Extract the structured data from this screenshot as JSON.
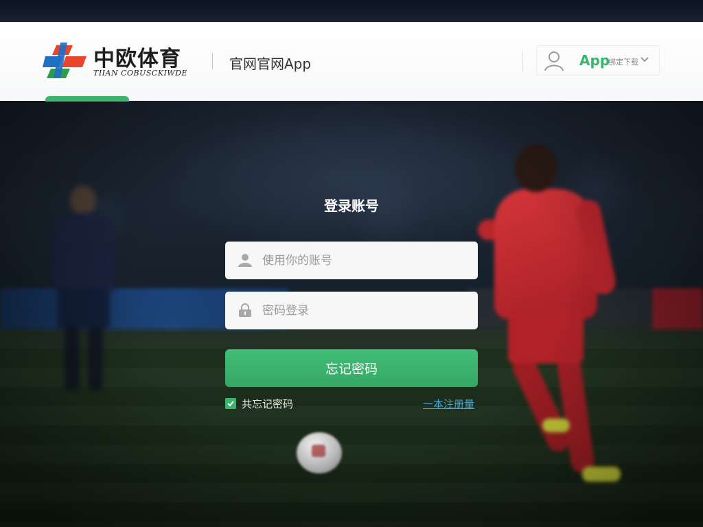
{
  "header": {
    "logo_cn": "中欧体育",
    "logo_en": "TIIAN COBUSCKIWDE",
    "site_link": "官网官网App",
    "user_menu": {
      "app_label": "App",
      "sub_label": "绑定下载",
      "icon": "user-icon",
      "chevron": "chevron-down-icon"
    }
  },
  "login": {
    "title": "登录账号",
    "username": {
      "placeholder": "使用你的账号",
      "value": "",
      "icon": "user-icon"
    },
    "password": {
      "placeholder": "密码登录",
      "value": "",
      "icon": "lock-icon"
    },
    "submit_label": "忘记密码",
    "remember_label": "共忘记密码",
    "remember_checked": true,
    "register_link": "一本注册量"
  },
  "colors": {
    "accent_green": "#3cb46e",
    "link_blue": "#3fa6e0",
    "logo_red": "#e8452c",
    "logo_blue": "#1f6fc4",
    "logo_green": "#2e9c4f"
  }
}
